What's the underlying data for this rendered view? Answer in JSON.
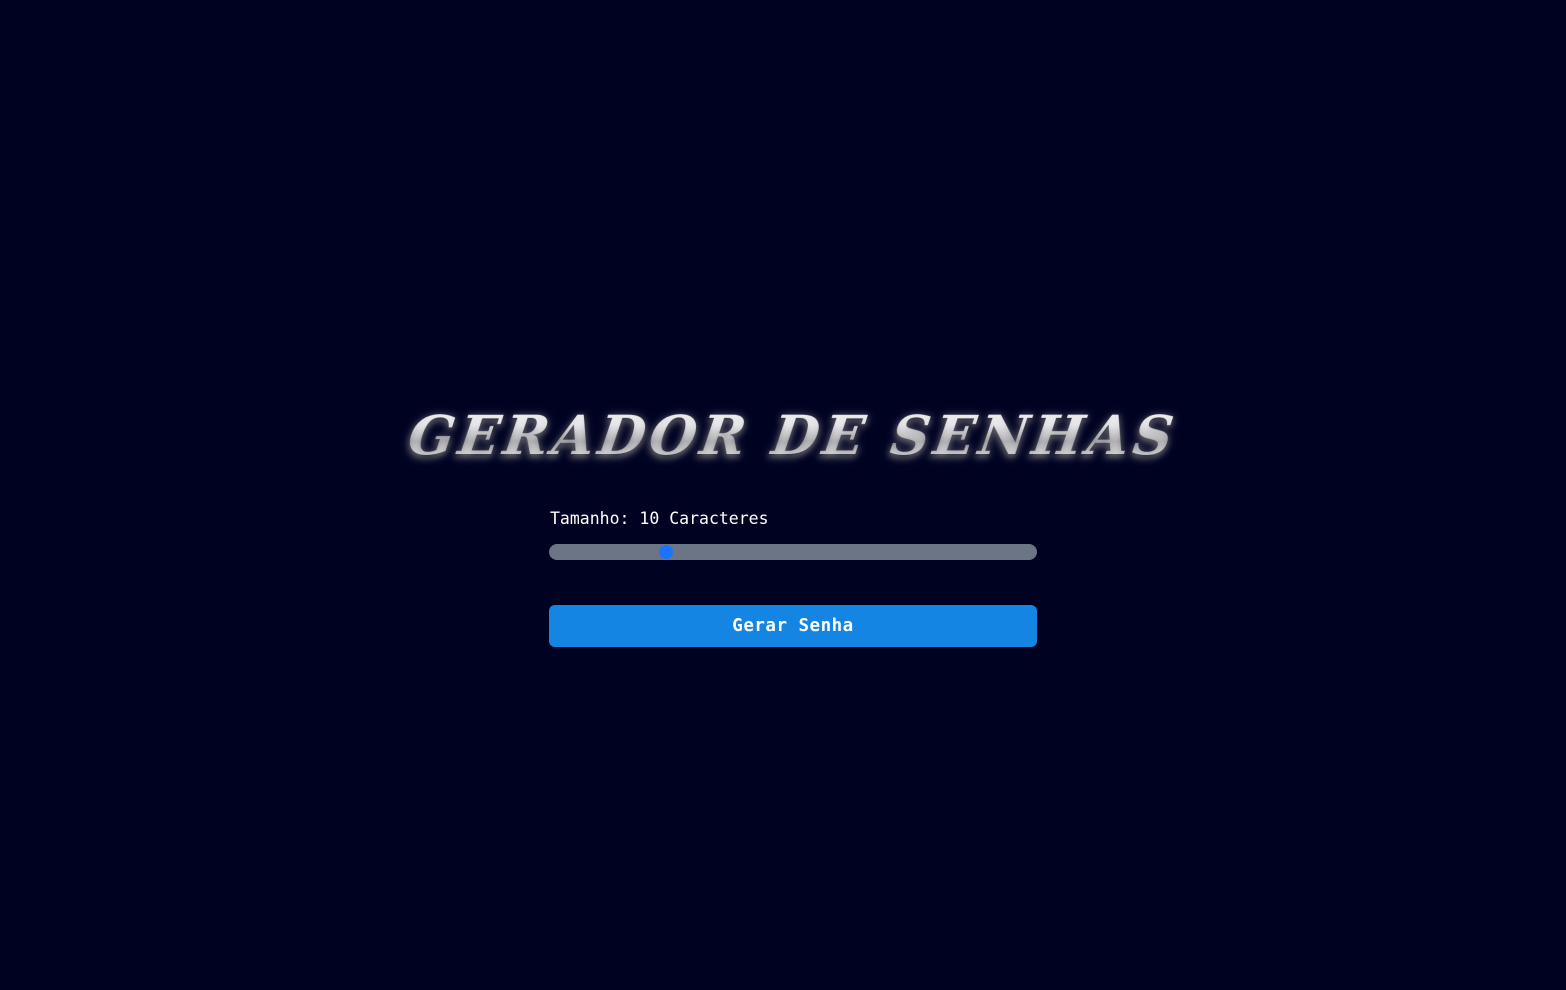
{
  "header": {
    "logo_text": "GERADOR DE SENHAS"
  },
  "length_control": {
    "label": "Tamanho: 10 Caracteres",
    "value": 10,
    "min": 4,
    "max": 30
  },
  "actions": {
    "generate_label": "Gerar Senha"
  },
  "colors": {
    "background": "#000222",
    "accent": "#1485e2",
    "slider_track": "#6c7585",
    "slider_thumb": "#1a73ff"
  }
}
